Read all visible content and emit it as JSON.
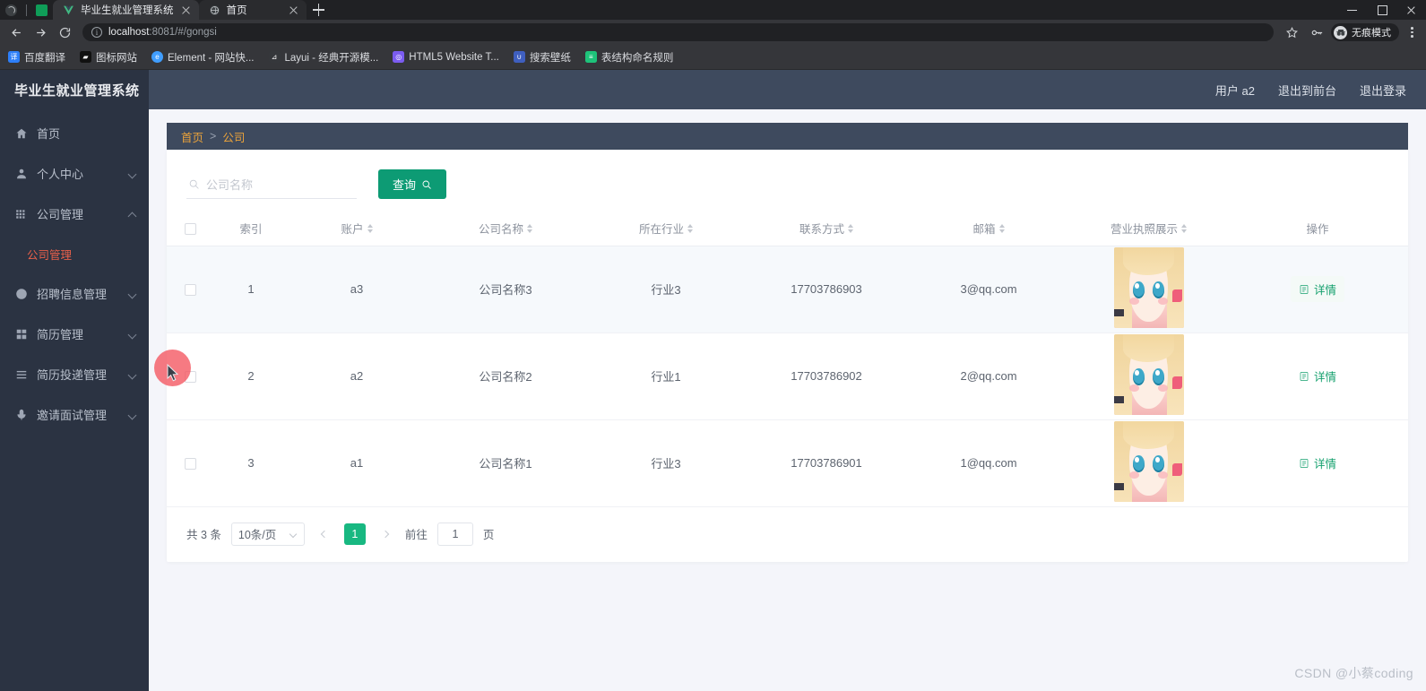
{
  "browser": {
    "tabs": [
      {
        "title": "毕业生就业管理系统",
        "favicon": "vue-logo-icon",
        "active": true
      },
      {
        "title": "首页",
        "favicon": "globe-icon",
        "active": false
      }
    ],
    "url_host": "localhost",
    "url_rest": ":8081/#/gongsi",
    "incognito_label": "无痕模式",
    "bookmarks": [
      {
        "label": "百度翻译",
        "icon": "translate-icon",
        "color": "#2d7ff9"
      },
      {
        "label": "图标网站",
        "icon": "flag-icon",
        "color": "#111111"
      },
      {
        "label": "Element - 网站快...",
        "icon": "element-icon",
        "color": "#409eff"
      },
      {
        "label": "Layui - 经典开源模...",
        "icon": "layui-icon",
        "color": "#35373b"
      },
      {
        "label": "HTML5 Website T...",
        "icon": "html5-icon",
        "color": "#7b5cf0"
      },
      {
        "label": "搜索壁纸",
        "icon": "wallpaper-icon",
        "color": "#3f5fbf"
      },
      {
        "label": "表结构命名规则",
        "icon": "note-icon",
        "color": "#1ec37a"
      }
    ]
  },
  "sidebar": {
    "brand": "毕业生就业管理系统",
    "items": [
      {
        "label": "首页",
        "icon": "home-icon",
        "expandable": false
      },
      {
        "label": "个人中心",
        "icon": "user-icon",
        "expandable": true,
        "expanded": false
      },
      {
        "label": "公司管理",
        "icon": "grid-icon",
        "expandable": true,
        "expanded": true
      },
      {
        "label": "招聘信息管理",
        "icon": "clock-icon",
        "expandable": true,
        "expanded": false
      },
      {
        "label": "简历管理",
        "icon": "doc-icon",
        "expandable": true,
        "expanded": false
      },
      {
        "label": "简历投递管理",
        "icon": "list-icon",
        "expandable": true,
        "expanded": false
      },
      {
        "label": "邀请面试管理",
        "icon": "mic-icon",
        "expandable": true,
        "expanded": false
      }
    ],
    "submenu": {
      "label": "公司管理",
      "active": true
    }
  },
  "topbar": {
    "user_label": "用户 a2",
    "exit_front_label": "退出到前台",
    "logout_label": "退出登录"
  },
  "breadcrumb": {
    "home": "首页",
    "separator": ">",
    "current": "公司"
  },
  "search": {
    "placeholder": "公司名称",
    "value": "",
    "button_label": "查询"
  },
  "table": {
    "columns": [
      {
        "label": "",
        "key": "checkbox",
        "sortable": false
      },
      {
        "label": "索引",
        "key": "index",
        "sortable": false
      },
      {
        "label": "账户",
        "key": "account",
        "sortable": true
      },
      {
        "label": "公司名称",
        "key": "company",
        "sortable": true
      },
      {
        "label": "所在行业",
        "key": "industry",
        "sortable": true
      },
      {
        "label": "联系方式",
        "key": "phone",
        "sortable": true
      },
      {
        "label": "邮箱",
        "key": "email",
        "sortable": true
      },
      {
        "label": "营业执照展示",
        "key": "license",
        "sortable": true
      },
      {
        "label": "操作",
        "key": "action",
        "sortable": false
      }
    ],
    "rows": [
      {
        "index": "1",
        "account": "a3",
        "company": "公司名称3",
        "industry": "行业3",
        "phone": "17703786903",
        "email": "3@qq.com",
        "license": "license-thumbnail",
        "action": "详情",
        "hovered": true
      },
      {
        "index": "2",
        "account": "a2",
        "company": "公司名称2",
        "industry": "行业1",
        "phone": "17703786902",
        "email": "2@qq.com",
        "license": "license-thumbnail",
        "action": "详情",
        "hovered": false
      },
      {
        "index": "3",
        "account": "a1",
        "company": "公司名称1",
        "industry": "行业3",
        "phone": "17703786901",
        "email": "1@qq.com",
        "license": "license-thumbnail",
        "action": "详情",
        "hovered": false
      }
    ]
  },
  "pagination": {
    "total_label": "共 3 条",
    "page_size_label": "10条/页",
    "current_page": "1",
    "goto_label": "前往",
    "goto_value": "1",
    "page_unit": "页"
  },
  "watermark": "CSDN @小蔡coding",
  "colors": {
    "sidebar_bg": "#2b3342",
    "topbar_bg": "#3e4a5e",
    "accent_green": "#0d9b74",
    "pager_green": "#18b881",
    "submenu_red": "#e8604a",
    "crumb_orange": "#e9a23b",
    "page_bg": "#f4f5fa"
  }
}
